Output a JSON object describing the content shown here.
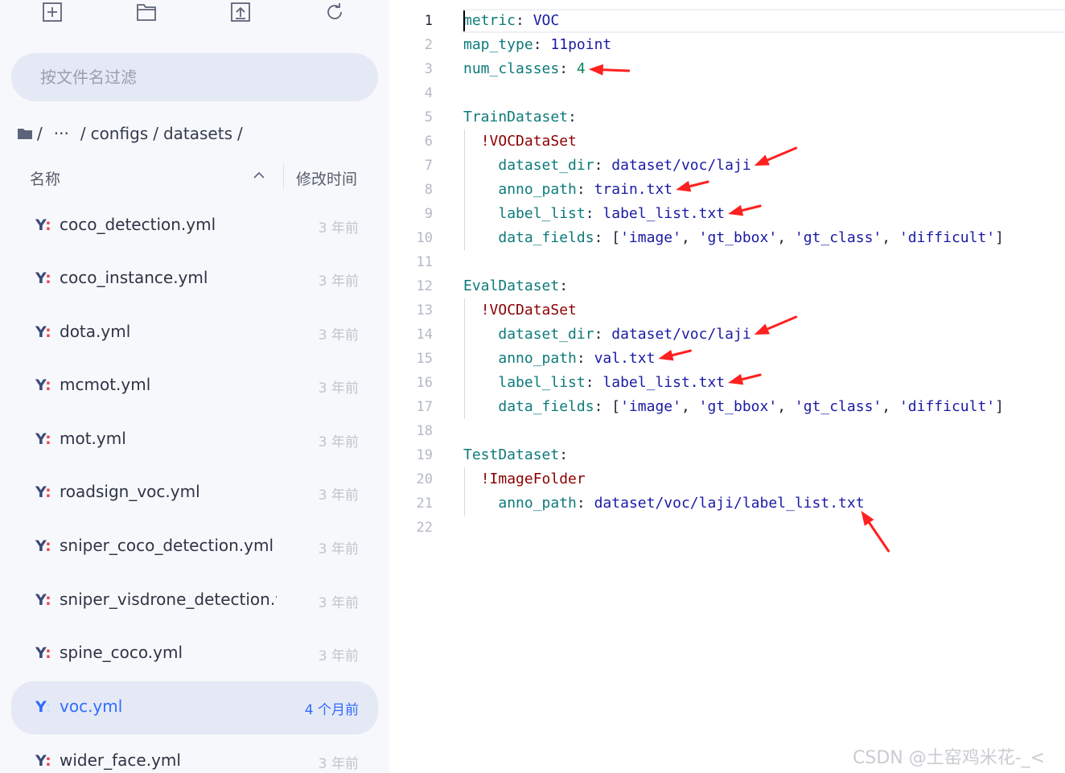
{
  "toolbar": {
    "buttons": [
      {
        "icon": "new-file-icon"
      },
      {
        "icon": "new-folder-icon"
      },
      {
        "icon": "upload-icon"
      },
      {
        "icon": "refresh-icon"
      }
    ]
  },
  "filter": {
    "placeholder": "按文件名过滤",
    "value": ""
  },
  "breadcrumb": {
    "root": "/",
    "ellipsis": "···",
    "parts": [
      "configs",
      "datasets"
    ],
    "sep": "/"
  },
  "list_header": {
    "name_label": "名称",
    "mtime_label": "修改时间",
    "sort": "ascending"
  },
  "files": [
    {
      "icon": "Y",
      "name": "coco_detection.yml",
      "mtime": "3 年前",
      "selected": false
    },
    {
      "icon": "Y",
      "name": "coco_instance.yml",
      "mtime": "3 年前",
      "selected": false
    },
    {
      "icon": "Y",
      "name": "dota.yml",
      "mtime": "3 年前",
      "selected": false
    },
    {
      "icon": "Y",
      "name": "mcmot.yml",
      "mtime": "3 年前",
      "selected": false
    },
    {
      "icon": "Y",
      "name": "mot.yml",
      "mtime": "3 年前",
      "selected": false
    },
    {
      "icon": "Y",
      "name": "roadsign_voc.yml",
      "mtime": "3 年前",
      "selected": false
    },
    {
      "icon": "Y",
      "name": "sniper_coco_detection.yml",
      "mtime": "3 年前",
      "selected": false
    },
    {
      "icon": "Y",
      "name": "sniper_visdrone_detection.yn",
      "mtime": "3 年前",
      "selected": false
    },
    {
      "icon": "Y",
      "name": "spine_coco.yml",
      "mtime": "3 年前",
      "selected": false
    },
    {
      "icon": "Y",
      "name": "voc.yml",
      "mtime": "4 个月前",
      "selected": true
    },
    {
      "icon": "Y",
      "name": "wider_face.yml",
      "mtime": "3 年前",
      "selected": false
    }
  ],
  "editor": {
    "current_line": 1,
    "lines": [
      {
        "n": "1",
        "tokens": [
          {
            "c": "k",
            "t": "metric"
          },
          {
            "c": "p",
            "t": ": "
          },
          {
            "c": "v",
            "t": "VOC"
          }
        ]
      },
      {
        "n": "2",
        "tokens": [
          {
            "c": "k",
            "t": "map_type"
          },
          {
            "c": "p",
            "t": ": "
          },
          {
            "c": "v",
            "t": "11point"
          }
        ]
      },
      {
        "n": "3",
        "tokens": [
          {
            "c": "k",
            "t": "num_classes"
          },
          {
            "c": "p",
            "t": ": "
          },
          {
            "c": "n",
            "t": "4"
          }
        ]
      },
      {
        "n": "4",
        "tokens": []
      },
      {
        "n": "5",
        "tokens": [
          {
            "c": "k",
            "t": "TrainDataset"
          },
          {
            "c": "p",
            "t": ":"
          }
        ]
      },
      {
        "n": "6",
        "tokens": [
          {
            "c": "p",
            "t": "  "
          },
          {
            "c": "t",
            "t": "!VOCDataSet"
          }
        ]
      },
      {
        "n": "7",
        "tokens": [
          {
            "c": "p",
            "t": "    "
          },
          {
            "c": "k",
            "t": "dataset_dir"
          },
          {
            "c": "p",
            "t": ": "
          },
          {
            "c": "v",
            "t": "dataset/voc/laji"
          }
        ]
      },
      {
        "n": "8",
        "tokens": [
          {
            "c": "p",
            "t": "    "
          },
          {
            "c": "k",
            "t": "anno_path"
          },
          {
            "c": "p",
            "t": ": "
          },
          {
            "c": "v",
            "t": "train.txt"
          }
        ]
      },
      {
        "n": "9",
        "tokens": [
          {
            "c": "p",
            "t": "    "
          },
          {
            "c": "k",
            "t": "label_list"
          },
          {
            "c": "p",
            "t": ": "
          },
          {
            "c": "v",
            "t": "label_list.txt"
          }
        ]
      },
      {
        "n": "10",
        "tokens": [
          {
            "c": "p",
            "t": "    "
          },
          {
            "c": "k",
            "t": "data_fields"
          },
          {
            "c": "p",
            "t": ": ["
          },
          {
            "c": "str",
            "t": "'image'"
          },
          {
            "c": "p",
            "t": ", "
          },
          {
            "c": "str",
            "t": "'gt_bbox'"
          },
          {
            "c": "p",
            "t": ", "
          },
          {
            "c": "str",
            "t": "'gt_class'"
          },
          {
            "c": "p",
            "t": ", "
          },
          {
            "c": "str",
            "t": "'difficult'"
          },
          {
            "c": "p",
            "t": "]"
          }
        ]
      },
      {
        "n": "11",
        "tokens": []
      },
      {
        "n": "12",
        "tokens": [
          {
            "c": "k",
            "t": "EvalDataset"
          },
          {
            "c": "p",
            "t": ":"
          }
        ]
      },
      {
        "n": "13",
        "tokens": [
          {
            "c": "p",
            "t": "  "
          },
          {
            "c": "t",
            "t": "!VOCDataSet"
          }
        ]
      },
      {
        "n": "14",
        "tokens": [
          {
            "c": "p",
            "t": "    "
          },
          {
            "c": "k",
            "t": "dataset_dir"
          },
          {
            "c": "p",
            "t": ": "
          },
          {
            "c": "v",
            "t": "dataset/voc/laji"
          }
        ]
      },
      {
        "n": "15",
        "tokens": [
          {
            "c": "p",
            "t": "    "
          },
          {
            "c": "k",
            "t": "anno_path"
          },
          {
            "c": "p",
            "t": ": "
          },
          {
            "c": "v",
            "t": "val.txt"
          }
        ]
      },
      {
        "n": "16",
        "tokens": [
          {
            "c": "p",
            "t": "    "
          },
          {
            "c": "k",
            "t": "label_list"
          },
          {
            "c": "p",
            "t": ": "
          },
          {
            "c": "v",
            "t": "label_list.txt"
          }
        ]
      },
      {
        "n": "17",
        "tokens": [
          {
            "c": "p",
            "t": "    "
          },
          {
            "c": "k",
            "t": "data_fields"
          },
          {
            "c": "p",
            "t": ": ["
          },
          {
            "c": "str",
            "t": "'image'"
          },
          {
            "c": "p",
            "t": ", "
          },
          {
            "c": "str",
            "t": "'gt_bbox'"
          },
          {
            "c": "p",
            "t": ", "
          },
          {
            "c": "str",
            "t": "'gt_class'"
          },
          {
            "c": "p",
            "t": ", "
          },
          {
            "c": "str",
            "t": "'difficult'"
          },
          {
            "c": "p",
            "t": "]"
          }
        ]
      },
      {
        "n": "18",
        "tokens": []
      },
      {
        "n": "19",
        "tokens": [
          {
            "c": "k",
            "t": "TestDataset"
          },
          {
            "c": "p",
            "t": ":"
          }
        ]
      },
      {
        "n": "20",
        "tokens": [
          {
            "c": "p",
            "t": "  "
          },
          {
            "c": "t",
            "t": "!ImageFolder"
          }
        ]
      },
      {
        "n": "21",
        "tokens": [
          {
            "c": "p",
            "t": "    "
          },
          {
            "c": "k",
            "t": "anno_path"
          },
          {
            "c": "p",
            "t": ": "
          },
          {
            "c": "v",
            "t": "dataset/voc/laji/label_list.txt"
          }
        ]
      },
      {
        "n": "22",
        "tokens": []
      }
    ]
  },
  "annotation_arrows_on_lines": [
    3,
    7,
    8,
    9,
    14,
    15,
    16,
    21
  ],
  "arrow_color": "#ff2020",
  "watermark": "CSDN @土窑鸡米花-_<",
  "colors": {
    "accent": "#2f6bff",
    "selected_row_bg": "#e4e9f5",
    "sidebar_bg": "#f7f8fb"
  }
}
